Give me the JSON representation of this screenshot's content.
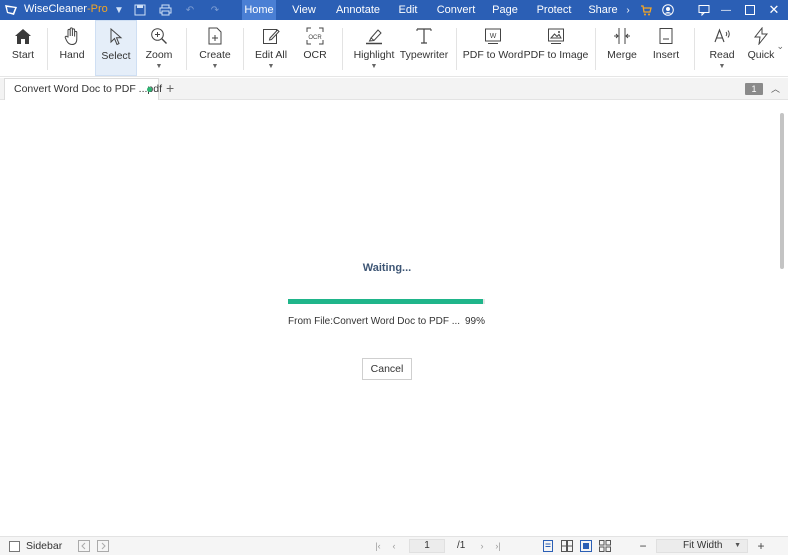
{
  "app": {
    "name": "WiseCleaner",
    "edition": "-Pro",
    "accent": "#2b5fb5",
    "active_menu_color": "#4a7fd4"
  },
  "titlebar": {
    "quick_icons": [
      "dropdown-icon",
      "save-icon",
      "print-icon",
      "undo-icon",
      "redo-icon"
    ],
    "menus": [
      {
        "label": "Home",
        "active": true
      },
      {
        "label": "View",
        "active": false
      },
      {
        "label": "Annotate",
        "active": false
      },
      {
        "label": "Edit",
        "active": false
      },
      {
        "label": "Convert",
        "active": false
      },
      {
        "label": "Page",
        "active": false
      },
      {
        "label": "Protect",
        "active": false
      },
      {
        "label": "Share",
        "active": false
      }
    ],
    "right_icons": [
      "more-menu-icon",
      "cart-icon",
      "account-icon",
      "feedback-icon",
      "minimize-icon",
      "maximize-icon",
      "close-icon"
    ]
  },
  "toolbar": {
    "tools": [
      {
        "label": "Start",
        "icon": "home-icon"
      },
      {
        "label": "Hand",
        "icon": "hand-icon"
      },
      {
        "label": "Select",
        "icon": "cursor-icon",
        "selected": true
      },
      {
        "label": "Zoom",
        "icon": "zoom-icon",
        "dropdown": true
      },
      {
        "label": "Create",
        "icon": "create-icon",
        "dropdown": true
      },
      {
        "label": "Edit All",
        "icon": "edit-icon",
        "dropdown": true
      },
      {
        "label": "OCR",
        "icon": "ocr-icon"
      },
      {
        "label": "Highlight",
        "icon": "highlight-icon",
        "dropdown": true
      },
      {
        "label": "Typewriter",
        "icon": "typewriter-icon"
      },
      {
        "label": "PDF to Word",
        "icon": "pdf-to-word-icon"
      },
      {
        "label": "PDF to Image",
        "icon": "pdf-to-image-icon"
      },
      {
        "label": "Merge",
        "icon": "merge-icon"
      },
      {
        "label": "Insert",
        "icon": "insert-icon"
      },
      {
        "label": "Read",
        "icon": "read-icon",
        "dropdown": true
      },
      {
        "label": "Quick",
        "icon": "quick-icon"
      }
    ]
  },
  "tabs": {
    "document_tab": "Convert Word Doc to PDF ...pdf",
    "status_dot_color": "#2db673",
    "add_symbol": "+",
    "page_badge": "1"
  },
  "dialog": {
    "title": "Waiting...",
    "progress": 0.99,
    "progress_color": "#1fb58a",
    "source_text": "From File:Convert Word Doc to PDF ...",
    "percent_text": "99%",
    "cancel_label": "Cancel"
  },
  "statusbar": {
    "sidebar_label": "Sidebar",
    "current_page": "1",
    "total_pages": "/1",
    "zoom": "Fit Width",
    "zoom_minus": "−",
    "zoom_plus": "+"
  }
}
